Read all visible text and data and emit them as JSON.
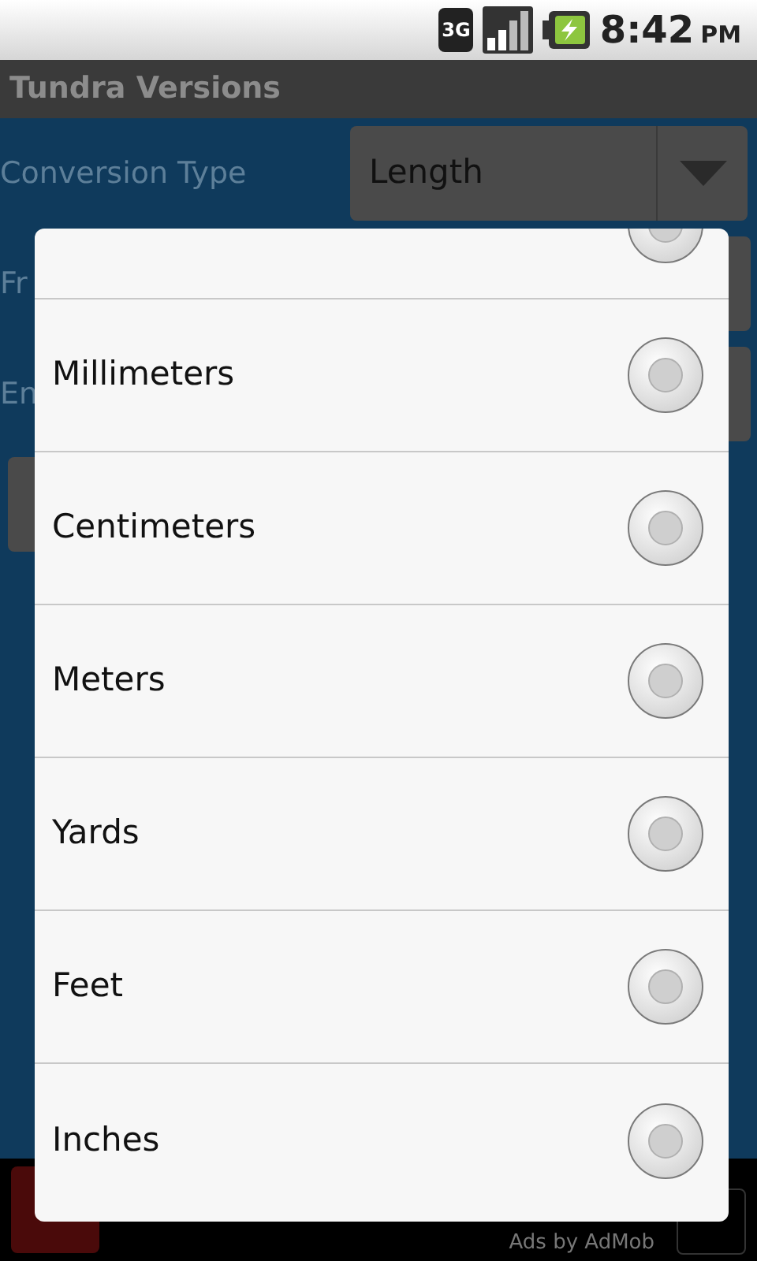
{
  "status_bar": {
    "network": "3G",
    "time": "8:42",
    "ampm": "PM"
  },
  "title_bar": {
    "title": "Tundra Versions"
  },
  "form": {
    "conversion_label": "Conversion Type",
    "conversion_value": "Length",
    "from_label": "Fr",
    "enter_label": "En"
  },
  "dialog": {
    "partial_row": {
      "selected": false
    },
    "options": [
      {
        "label": "Millimeters",
        "selected": false
      },
      {
        "label": "Centimeters",
        "selected": false
      },
      {
        "label": "Meters",
        "selected": false
      },
      {
        "label": "Yards",
        "selected": false
      },
      {
        "label": "Feet",
        "selected": false
      },
      {
        "label": "Inches",
        "selected": false
      }
    ]
  },
  "ad_bar": {
    "text": "Ads by AdMob"
  }
}
